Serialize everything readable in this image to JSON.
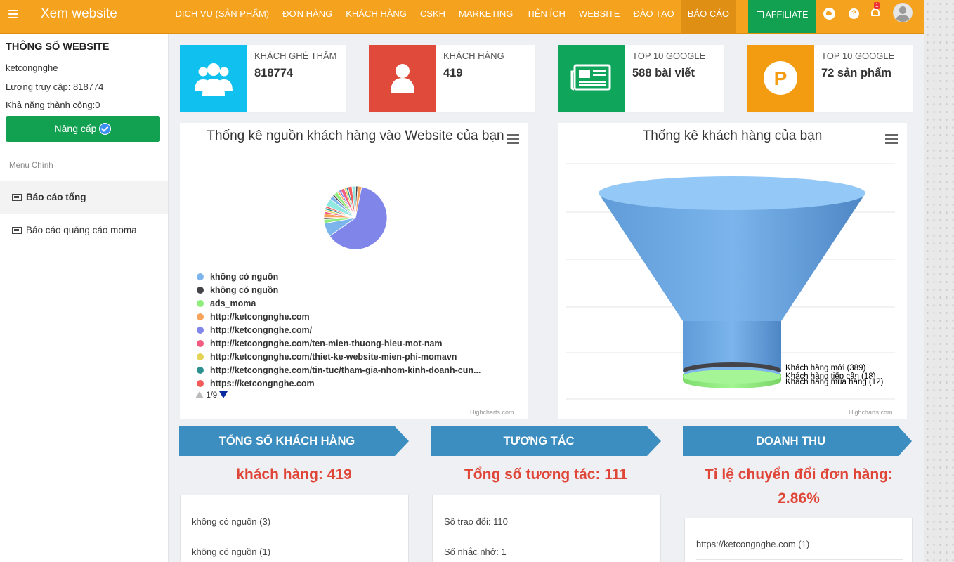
{
  "app": {
    "title": "Xem website"
  },
  "nav": {
    "items": [
      "DỊCH VỤ (SẢN PHẨM)",
      "ĐƠN HÀNG",
      "KHÁCH HÀNG",
      "CSKH",
      "MARKETING",
      "TIỆN ÍCH",
      "WEBSITE",
      "ĐÀO TẠO",
      "BÁO CÁO"
    ],
    "active": "BÁO CÁO",
    "affiliate": "AFFILIATE",
    "notification_count": "1",
    "help": "?"
  },
  "sidebar": {
    "title": "THÔNG SỐ WEBSITE",
    "site": "ketcongnghe",
    "visits": "Lượng truy cập: 818774",
    "success": "Khả năng thành công:0",
    "upgrade": "Nâng cấp",
    "menu_heading": "Menu Chính",
    "menu": [
      "Báo cáo tổng",
      "Báo cáo quảng cáo moma"
    ]
  },
  "stats": [
    {
      "label": "KHÁCH GHÉ THĂM",
      "value": "818774",
      "color": "#10c0ef",
      "icon": "users-icon"
    },
    {
      "label": "KHÁCH HÀNG",
      "value": "419",
      "color": "#e04a3a",
      "icon": "user-icon"
    },
    {
      "label": "TOP 10 GOOGLE",
      "value": "588 bài viết",
      "color": "#0fa65b",
      "icon": "newspaper-icon"
    },
    {
      "label": "TOP 10 GOOGLE",
      "value": "72 sản phẩm",
      "color": "#f39c12",
      "icon": "product-p-icon"
    }
  ],
  "pie_panel": {
    "title": "Thống kê nguồn khách hàng vào Website của bạn",
    "legend": [
      {
        "label": "không có nguồn",
        "color": "#7cb5ec"
      },
      {
        "label": "không có nguồn",
        "color": "#434348"
      },
      {
        "label": "ads_moma",
        "color": "#90ed7d"
      },
      {
        "label": "http://ketcongnghe.com",
        "color": "#f7a35c"
      },
      {
        "label": "http://ketcongnghe.com/",
        "color": "#8085e9"
      },
      {
        "label": "http://ketcongnghe.com/ten-mien-thuong-hieu-mot-nam",
        "color": "#f15c80"
      },
      {
        "label": "http://ketcongnghe.com/thiet-ke-website-mien-phi-momavn",
        "color": "#e4d354"
      },
      {
        "label": "http://ketcongnghe.com/tin-tuc/tham-gia-nhom-kinh-doanh-cun...",
        "color": "#2b908f"
      },
      {
        "label": "https://ketcongnghe.com",
        "color": "#f45b5b"
      }
    ],
    "pager": "1/9",
    "credit": "Highcharts.com"
  },
  "funnel_panel": {
    "title": "Thống kê khách hàng của bạn",
    "labels": [
      "Khách hàng mới (389)",
      "Khách hàng tiếp cận (18)",
      "Khách hàng mua hàng (12)"
    ],
    "credit": "Highcharts.com"
  },
  "chart_data": [
    {
      "type": "pie",
      "title": "Thống kê nguồn khách hàng vào Website của bạn",
      "legend_page": "1/9",
      "visible_series_labels": [
        "không có nguồn",
        "không có nguồn",
        "ads_moma",
        "http://ketcongnghe.com",
        "http://ketcongnghe.com/",
        "http://ketcongnghe.com/ten-mien-thuong-hieu-mot-nam",
        "http://ketcongnghe.com/thiet-ke-website-mien-phi-momavn",
        "http://ketcongnghe.com/tin-tuc/tham-gia-nhom-kinh-doanh-cun...",
        "https://ketcongnghe.com"
      ],
      "slices": [
        {
          "color": "#8085e9",
          "value": 62
        },
        {
          "color": "#7cb5ec",
          "value": 7
        },
        {
          "color": "#90ed7d",
          "value": 2
        },
        {
          "color": "#434348",
          "value": 1
        },
        {
          "color": "#f7a35c",
          "value": 2
        },
        {
          "color": "#f15c80",
          "value": 1
        },
        {
          "color": "#e4d354",
          "value": 1
        },
        {
          "color": "#2b908f",
          "value": 1
        },
        {
          "color": "#f45b5b",
          "value": 1
        },
        {
          "color": "#91e8e1",
          "value": 4
        },
        {
          "color": "#7cb5ec",
          "value": 2
        },
        {
          "color": "#434348",
          "value": 1
        },
        {
          "color": "#90ed7d",
          "value": 2
        },
        {
          "color": "#f7a35c",
          "value": 1
        },
        {
          "color": "#8085e9",
          "value": 1
        },
        {
          "color": "#f15c80",
          "value": 2
        },
        {
          "color": "#e4d354",
          "value": 1
        },
        {
          "color": "#2b908f",
          "value": 1
        },
        {
          "color": "#f45b5b",
          "value": 2
        },
        {
          "color": "#91e8e1",
          "value": 2
        },
        {
          "color": "#434348",
          "value": 1
        },
        {
          "color": "#f7a35c",
          "value": 2
        }
      ]
    },
    {
      "type": "funnel",
      "title": "Thống kê khách hàng của bạn",
      "categories": [
        "Khách hàng mới",
        "Khách hàng tiếp cận",
        "Khách hàng mua hàng"
      ],
      "values": [
        389,
        18,
        12
      ],
      "colors": [
        "#7cb5ec",
        "#434348",
        "#90ed7d"
      ]
    }
  ],
  "sections": [
    {
      "title": "TỔNG SỐ KHÁCH HÀNG",
      "big": "khách hàng: 419",
      "rows": [
        "không có nguồn (3)",
        "không có nguồn (1)"
      ]
    },
    {
      "title": "TƯƠNG TÁC",
      "big": "Tổng số tương tác: 111",
      "rows": [
        "Số trao đổi: 110",
        "Số nhắc nhở: 1"
      ]
    },
    {
      "title": "DOANH THU",
      "big_line1": "Tỉ lệ chuyển đổi đơn hàng:",
      "big_line2": "2.86%",
      "rows": [
        "https://ketcongnghe.com (1)"
      ]
    }
  ],
  "colors": {
    "topbar": "#f5a21e",
    "ribbon": "#3d8ec0",
    "accent_red": "#e04638",
    "green": "#12a150"
  }
}
